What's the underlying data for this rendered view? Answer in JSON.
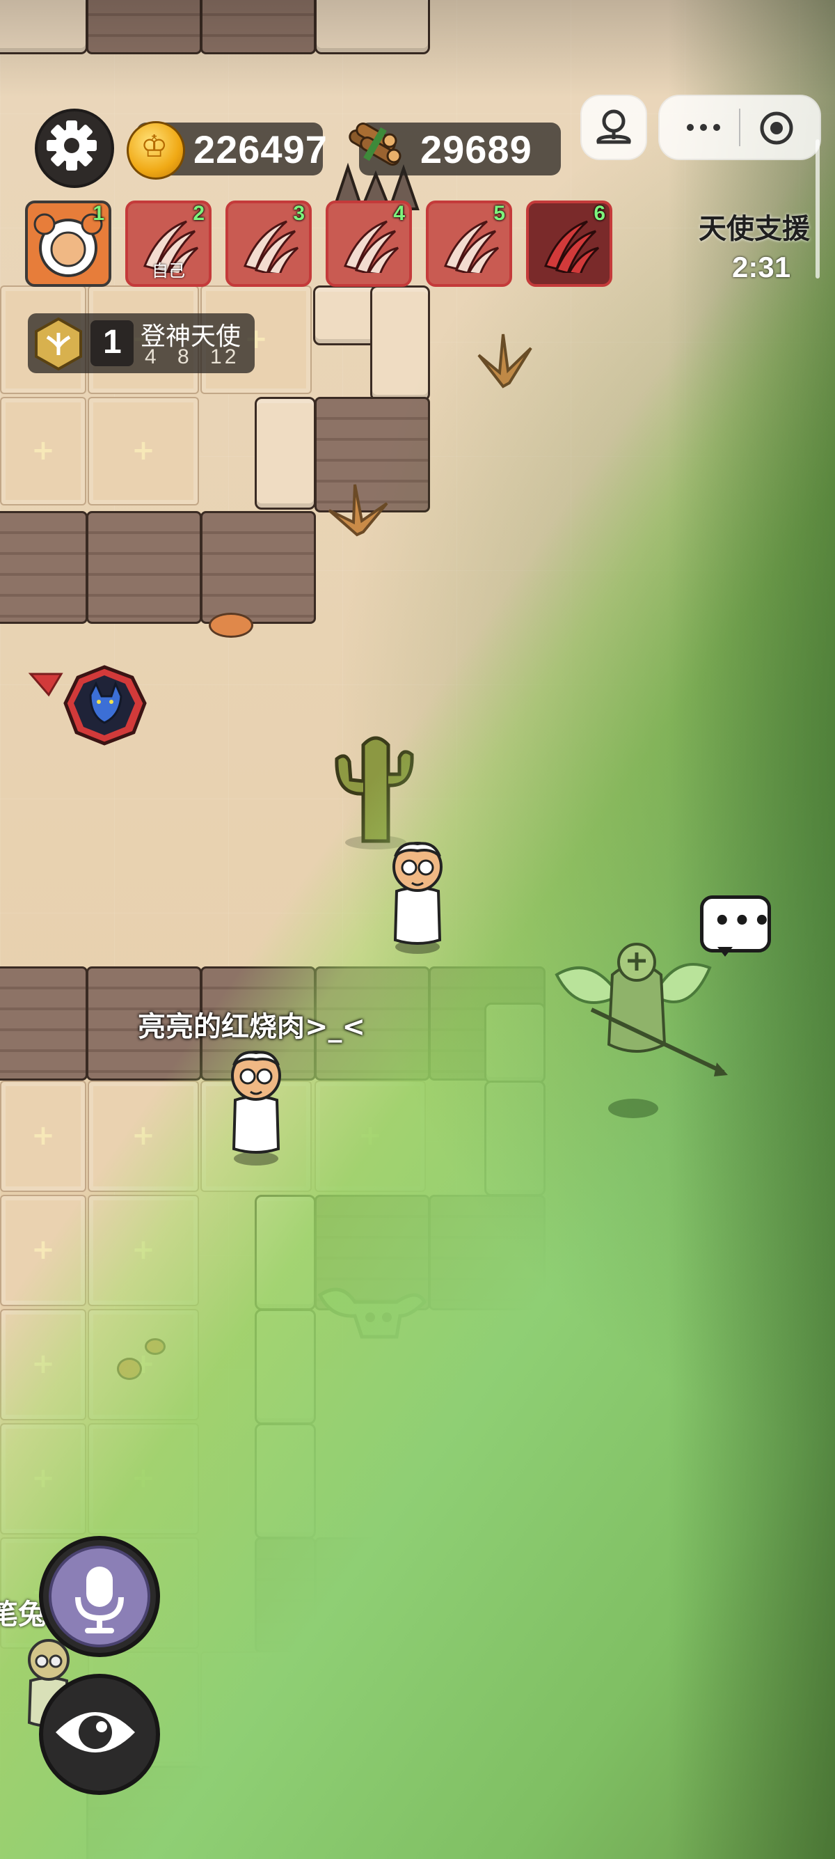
{
  "resources": {
    "gold": "226497",
    "wood": "29689"
  },
  "team": [
    {
      "slot": "1",
      "label": ""
    },
    {
      "slot": "2",
      "label": "自己"
    },
    {
      "slot": "3",
      "label": ""
    },
    {
      "slot": "4",
      "label": ""
    },
    {
      "slot": "5",
      "label": ""
    },
    {
      "slot": "6",
      "label": ""
    }
  ],
  "rank": {
    "level": "1",
    "title": "登神天使",
    "steps": "4 8 12"
  },
  "angel_support": {
    "title": "天使支援",
    "timer": "2:31"
  },
  "players": {
    "name": "亮亮的红烧肉>_<",
    "edge_name_fragment": "笔兔"
  },
  "icons": {
    "settings": "gear-icon",
    "gold": "coin-icon",
    "wood": "wood-icon",
    "mic": "microphone-icon",
    "view": "eye-icon",
    "chat": "speech-bubble-icon",
    "wolf": "wolf-head-icon",
    "rank": "winged-badge-icon"
  },
  "colors": {
    "toxic_zone": "#8fcf74",
    "team_border": "#c43a3a",
    "slot_number": "#7df37d"
  }
}
